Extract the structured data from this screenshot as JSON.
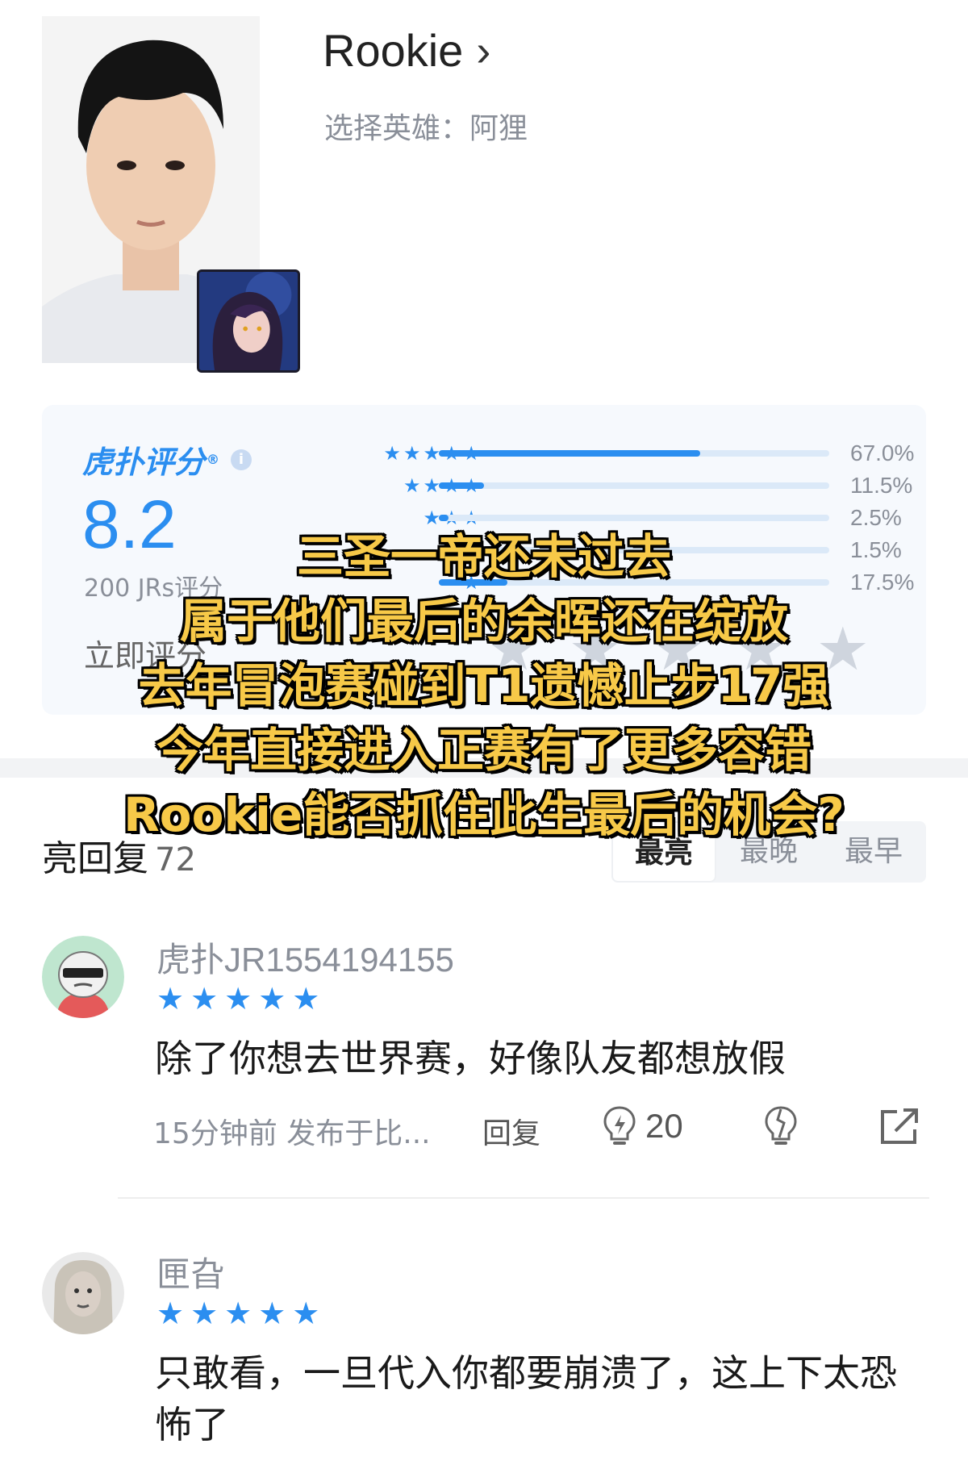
{
  "player": {
    "name": "Rookie",
    "chevron": "›",
    "hero_line": "选择英雄：阿狸"
  },
  "rating": {
    "brand": "虎扑评分",
    "brand_mark": "®",
    "info_icon": "i",
    "score": "8.2",
    "count_text": "200 JRs评分",
    "rate_now": "立即评分",
    "distribution": [
      {
        "stars": "★★★★★",
        "percent_text": "67.0%",
        "fraction": 0.67
      },
      {
        "stars": "★★★★",
        "percent_text": "11.5%",
        "fraction": 0.115
      },
      {
        "stars": "★★★",
        "percent_text": "2.5%",
        "fraction": 0.025
      },
      {
        "stars": "★★",
        "percent_text": "1.5%",
        "fraction": 0.015
      },
      {
        "stars": "★",
        "percent_text": "17.5%",
        "fraction": 0.175
      }
    ],
    "accent_color": "#2b8ef0"
  },
  "highlights": {
    "title": "亮回复",
    "count": "72",
    "tabs": [
      "最亮",
      "最晚",
      "最早"
    ],
    "active_tab": "最亮"
  },
  "comments": [
    {
      "user": "虎扑JR1554194155",
      "stars": "★★★★★",
      "text": "除了你想去世界赛，好像队友都想放假",
      "meta": "15分钟前 发布于比...",
      "reply": "回复",
      "likes": "20"
    },
    {
      "user": "匣旮",
      "stars": "★★★★★",
      "text": "只敢看，一旦代入你都要崩溃了，这上下太恐怖了"
    }
  ],
  "overlay": [
    "三圣一帝还未过去",
    "属于他们最后的余晖还在绽放",
    "去年冒泡赛碰到T1遗憾止步17强",
    "今年直接进入正赛有了更多容错",
    "Rookie能否抓住此生最后的机会?"
  ],
  "icons": {
    "like": "lightbulb-icon",
    "dislike": "broken-bulb-icon",
    "share": "share-icon",
    "rate_star": "star-icon"
  }
}
